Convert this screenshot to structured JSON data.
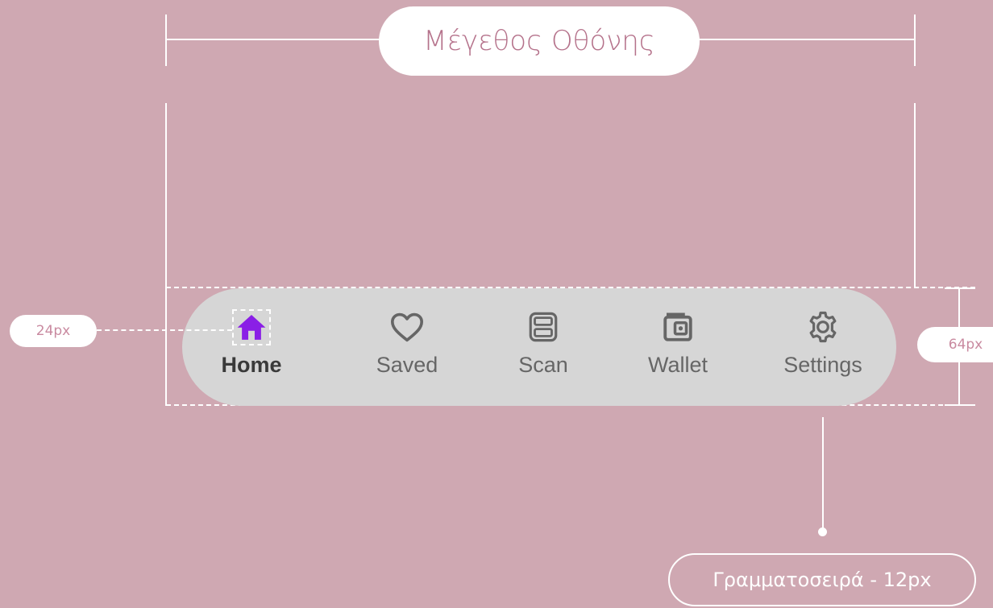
{
  "annotations": {
    "screen_size_label": "Μέγεθος Οθόνης",
    "icon_size_label": "24px",
    "bar_height_label": "64px",
    "font_label": "Γραμματοσειρά - 12px"
  },
  "navbar": {
    "items": [
      {
        "label": "Home",
        "icon": "home-icon",
        "active": true
      },
      {
        "label": "Saved",
        "icon": "heart-icon",
        "active": false
      },
      {
        "label": "Scan",
        "icon": "scan-icon",
        "active": false
      },
      {
        "label": "Wallet",
        "icon": "wallet-icon",
        "active": false
      },
      {
        "label": "Settings",
        "icon": "gear-icon",
        "active": false
      }
    ]
  },
  "colors": {
    "background": "#cfa8b2",
    "navbar": "#d6d6d6",
    "active_icon": "#8a1fe6",
    "inactive": "#666666"
  }
}
